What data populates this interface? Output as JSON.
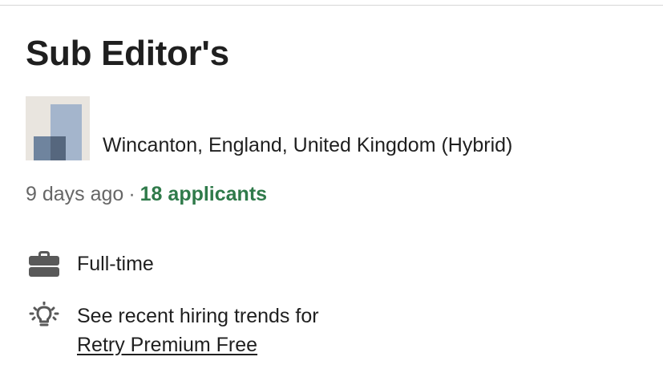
{
  "job": {
    "title": "Sub Editor's",
    "location": "Wincanton, England, United Kingdom (Hybrid)",
    "posted": "9 days ago",
    "separator": "·",
    "applicants": "18 applicants"
  },
  "insights": {
    "employment_type": {
      "icon": "briefcase-icon",
      "label": "Full-time"
    },
    "hiring_trends": {
      "icon": "lightbulb-icon",
      "label": "See recent hiring trends for",
      "link_label": "Retry Premium Free"
    }
  },
  "colors": {
    "applicants_green": "#2f7a4a",
    "muted_text": "#666666",
    "primary_text": "#1f1f1f"
  }
}
